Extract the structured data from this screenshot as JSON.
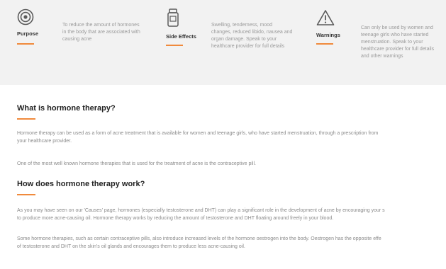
{
  "summary": {
    "purpose": {
      "icon": "target-icon",
      "title": "Purpose",
      "lines": [
        "To reduce the amount of hormones",
        "in the body that are associated with",
        "causing acne"
      ]
    },
    "side_effects": {
      "icon": "pill-bottle-icon",
      "title": "Side Effects",
      "lines": [
        "Swelling, tenderness, mood",
        "changes, reduced libido, nausea and",
        "organ damage. Speak to your",
        "healthcare provider for full details"
      ]
    },
    "warnings": {
      "icon": "warning-triangle-icon",
      "title": "Warnings",
      "lines": [
        "Can only be used by women and",
        "teenage girls who have started",
        "menstruation. Speak to your",
        "healthcare provider for full details",
        "and other warnings"
      ]
    }
  },
  "section1": {
    "heading": "What is hormone therapy?",
    "para1_lines": [
      "Hormone therapy can be used as a form of acne treatment that is available for women and teenage girls, who have started menstruation, through a prescription from",
      "your healthcare provider."
    ],
    "para2_lines": [
      "One of the most well known hormone therapies that is used for the treatment of acne is the contraceptive pill."
    ]
  },
  "section2": {
    "heading": "How does hormone therapy work?",
    "para1_lines": [
      "As you may have seen on our 'Causes' page, hormones (especially testosterone and DHT) can play a significant role in the development of acne by encouraging your s",
      "to produce more acne-causing oil. Hormone therapy works by reducing the amount of testosterone and DHT floating around freely in your blood."
    ],
    "para2_lines": [
      "Some hormone therapies, such as certain contraceptive pills, also introduce increased levels of the hormone oestrogen into the body. Oestrogen has the opposite effe",
      "of testosterone and DHT on the skin's oil glands and encourages them to produce less acne-causing oil."
    ]
  },
  "colors": {
    "accent": "#f08a3c",
    "band_background": "#f2f2f2",
    "heading": "#222222",
    "body_text": "#8a8a8a"
  }
}
